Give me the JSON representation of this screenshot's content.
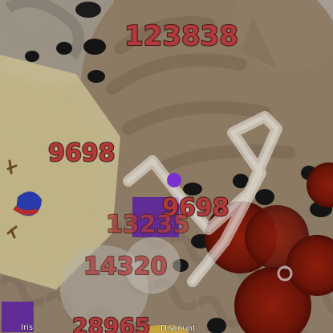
{
  "scores": {
    "top": "123838",
    "left_mid": "9698",
    "right_mid": "9698",
    "center": "13235",
    "lower": "14320",
    "bottom": "28965"
  },
  "labels": {
    "tag_a": "Iris",
    "tag_b": "Discount"
  },
  "colors": {
    "score_fill": "#b23a3a",
    "score_stroke": "#4a1f1f",
    "player_dot": "#7a2fd1",
    "brown_pellet": "#6b1408"
  }
}
